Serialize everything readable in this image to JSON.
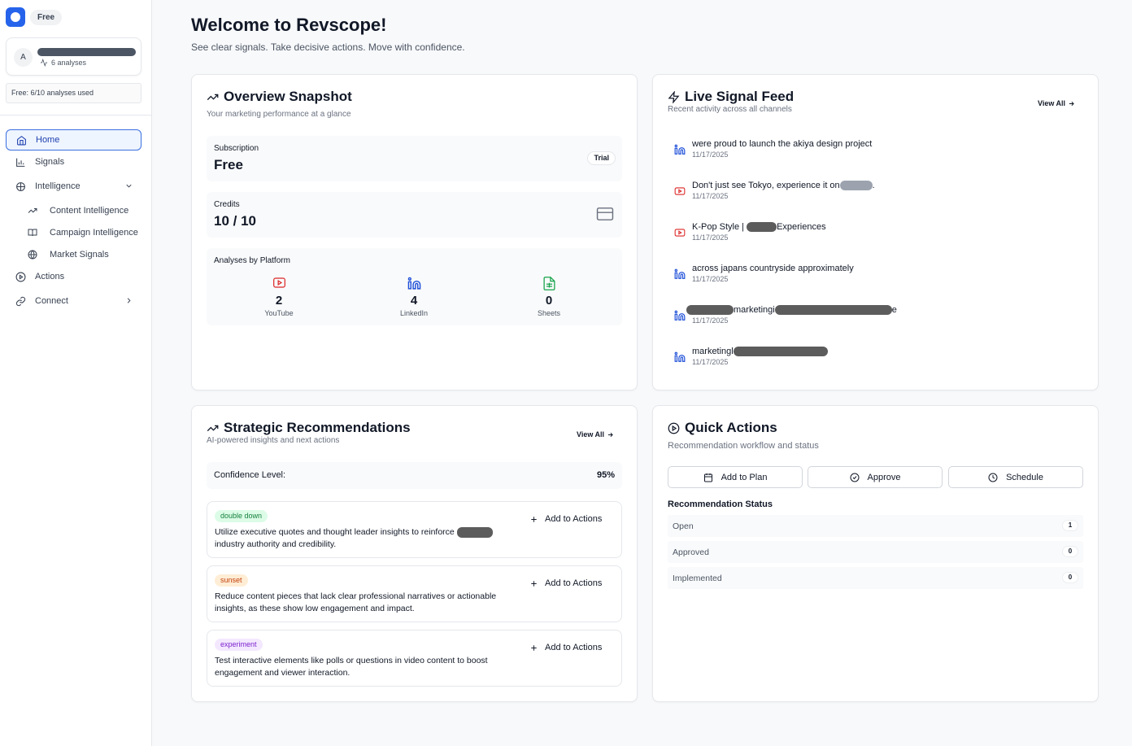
{
  "sidebar": {
    "plan_badge": "Free",
    "user": {
      "avatar_initial": "A",
      "analyses": "6 analyses"
    },
    "usage": "Free: 6/10 analyses used",
    "nav": {
      "home": "Home",
      "signals": "Signals",
      "intelligence": "Intelligence",
      "content_intelligence": "Content Intelligence",
      "campaign_intelligence": "Campaign Intelligence",
      "market_signals": "Market Signals",
      "actions": "Actions",
      "connect": "Connect"
    }
  },
  "header": {
    "title": "Welcome to Revscope!",
    "subtitle": "See clear signals. Take decisive actions. Move with confidence."
  },
  "overview": {
    "title": "Overview Snapshot",
    "subtitle": "Your marketing performance at a glance",
    "subscription": {
      "label": "Subscription",
      "value": "Free",
      "badge": "Trial"
    },
    "credits": {
      "label": "Credits",
      "value": "10 / 10"
    },
    "platforms": {
      "label": "Analyses by Platform",
      "items": [
        {
          "count": "2",
          "name": "YouTube"
        },
        {
          "count": "4",
          "name": "LinkedIn"
        },
        {
          "count": "0",
          "name": "Sheets"
        }
      ]
    }
  },
  "feed": {
    "title": "Live Signal Feed",
    "subtitle": "Recent activity across all channels",
    "view_all": "View All",
    "items": [
      {
        "platform": "linkedin",
        "text_a": "were proud to launch the akiya design project",
        "text_b": "",
        "date": "11/17/2025"
      },
      {
        "platform": "youtube",
        "text_a": "Don't just see Tokyo, experience it on",
        "text_b": ".",
        "date": "11/17/2025"
      },
      {
        "platform": "youtube",
        "text_a": "K-Pop Style | ",
        "text_b": "Experiences",
        "date": "11/17/2025"
      },
      {
        "platform": "linkedin",
        "text_a": "across japans countryside approximately",
        "text_b": "",
        "date": "11/17/2025"
      },
      {
        "platform": "linkedin",
        "text_a": "marketingi",
        "text_b": "e",
        "date": "11/17/2025"
      },
      {
        "platform": "linkedin",
        "text_a": "marketingl",
        "text_b": "",
        "date": "11/17/2025"
      }
    ]
  },
  "recommendations": {
    "title": "Strategic Recommendations",
    "subtitle": "AI-powered insights and next actions",
    "view_all": "View All",
    "confidence_label": "Confidence Level:",
    "confidence_value": "95%",
    "items": [
      {
        "tag": "double down",
        "text_a": "Utilize executive quotes and thought leader insights to reinforce",
        "text_b": " industry authority and credibility.",
        "action": "Add to Actions"
      },
      {
        "tag": "sunset",
        "text_a": "Reduce content pieces that lack clear professional narratives or actionable insights, as these show low engagement and impact.",
        "text_b": "",
        "action": "Add to Actions"
      },
      {
        "tag": "experiment",
        "text_a": "Test interactive elements like polls or questions in video content to boost engagement and viewer interaction.",
        "text_b": "",
        "action": "Add to Actions"
      }
    ]
  },
  "quick_actions": {
    "title": "Quick Actions",
    "subtitle": "Recommendation workflow and status",
    "buttons": {
      "add_to_plan": "Add to Plan",
      "approve": "Approve",
      "schedule": "Schedule"
    },
    "status_title": "Recommendation Status",
    "status": [
      {
        "label": "Open",
        "count": "1"
      },
      {
        "label": "Approved",
        "count": "0"
      },
      {
        "label": "Implemented",
        "count": "0"
      }
    ]
  },
  "colors": {
    "brand": "#2563eb",
    "youtube": "#dc2626",
    "linkedin": "#1d4ed8",
    "sheets": "#16a34a",
    "tag_double_down_bg": "#dcfce7",
    "tag_double_down_fg": "#15803d",
    "tag_sunset_bg": "#ffedd5",
    "tag_sunset_fg": "#c2410c",
    "tag_experiment_bg": "#f3e8ff",
    "tag_experiment_fg": "#7e22ce"
  }
}
